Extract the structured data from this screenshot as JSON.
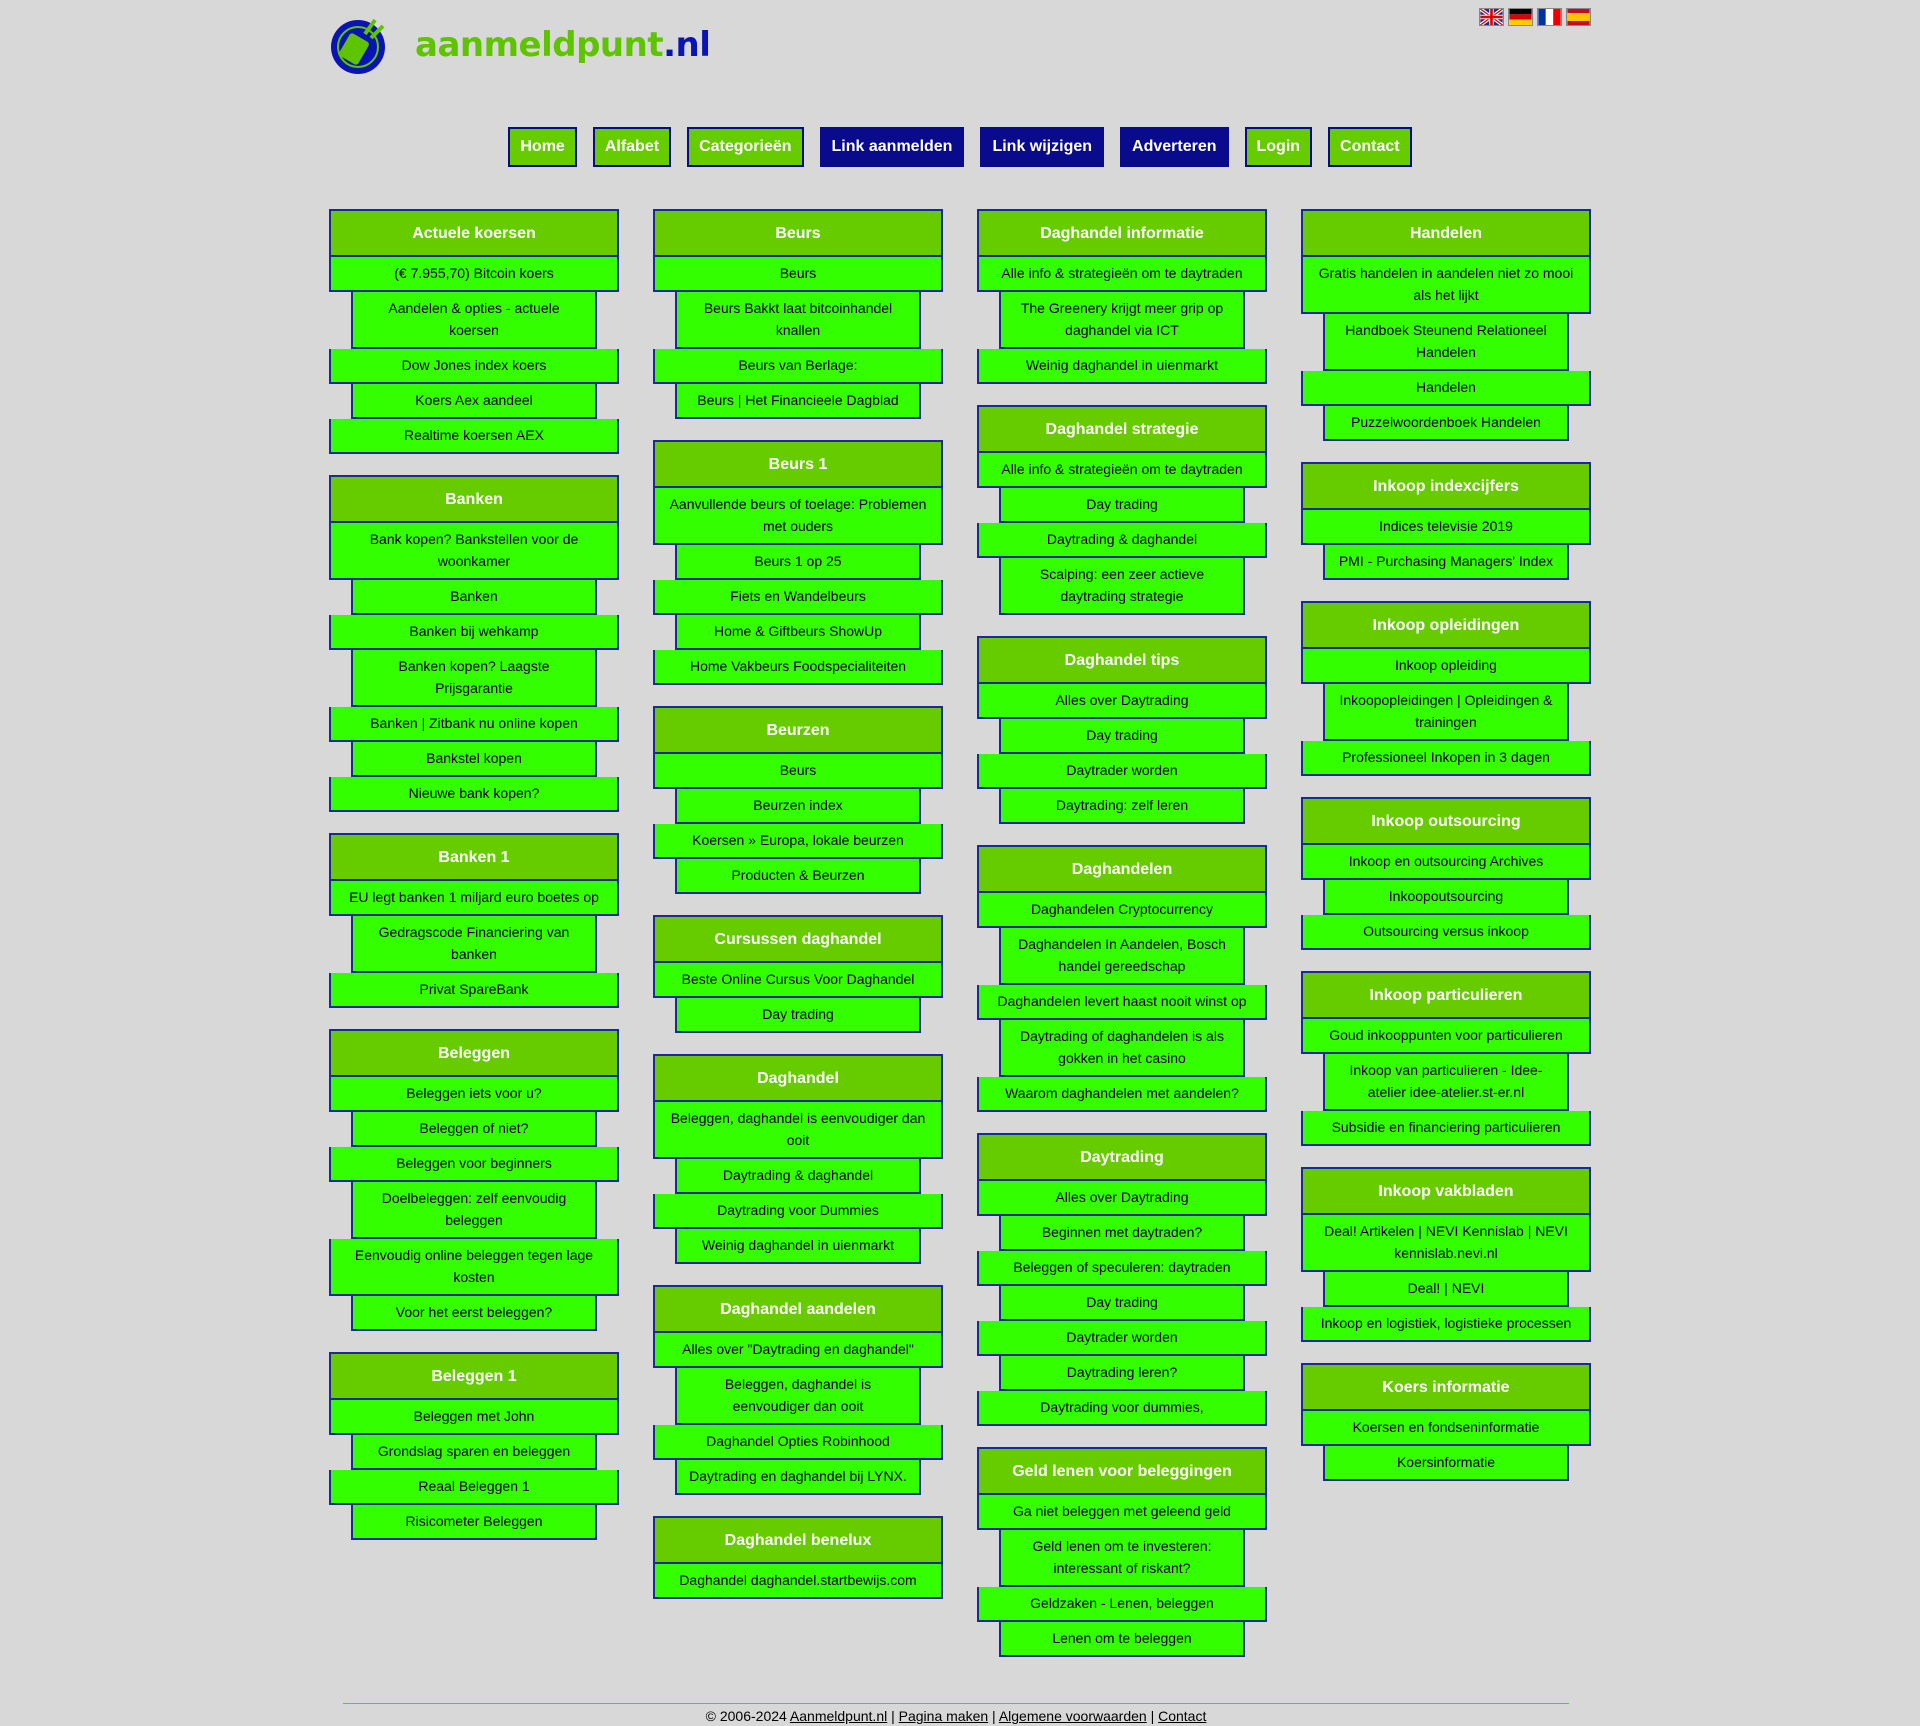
{
  "site": {
    "logo_text_green": "aanmeldpunt",
    "logo_text_blue": ".nl",
    "flags": [
      "flag-uk-icon",
      "flag-de-icon",
      "flag-fr-icon",
      "flag-es-icon"
    ]
  },
  "nav": [
    {
      "label": "Home",
      "dark": false
    },
    {
      "label": "Alfabet",
      "dark": false
    },
    {
      "label": "Categorieën",
      "dark": false
    },
    {
      "label": "Link aanmelden",
      "dark": true
    },
    {
      "label": "Link wijzigen",
      "dark": true
    },
    {
      "label": "Adverteren",
      "dark": true
    },
    {
      "label": "Login",
      "dark": false
    },
    {
      "label": "Contact",
      "dark": false
    }
  ],
  "columns": [
    [
      {
        "title": "Actuele koersen",
        "links": [
          "(€ 7.955,70) Bitcoin koers",
          "Aandelen & opties - actuele koersen",
          "Dow Jones index koers",
          "Koers Aex aandeel",
          "Realtime koersen AEX"
        ]
      },
      {
        "title": "Banken",
        "links": [
          "Bank kopen? Bankstellen voor de woonkamer",
          "Banken",
          "Banken bij wehkamp",
          "Banken kopen? Laagste Prijsgarantie",
          "Banken | Zitbank nu online kopen",
          "Bankstel kopen",
          "Nieuwe bank kopen?"
        ]
      },
      {
        "title": "Banken 1",
        "links": [
          "EU legt banken 1 miljard euro boetes op",
          "Gedragscode Financiering van banken",
          "Privat SpareBank"
        ]
      },
      {
        "title": "Beleggen",
        "links": [
          "Beleggen iets voor u?",
          "Beleggen of niet?",
          "Beleggen voor beginners",
          "Doelbeleggen: zelf eenvoudig beleggen",
          "Eenvoudig online beleggen tegen lage kosten",
          "Voor het eerst beleggen?"
        ]
      },
      {
        "title": "Beleggen 1",
        "links": [
          "Beleggen met John",
          "Grondslag sparen en beleggen",
          "Reaal Beleggen 1",
          "Risicometer Beleggen"
        ]
      }
    ],
    [
      {
        "title": "Beurs",
        "links": [
          "Beurs",
          "Beurs Bakkt laat bitcoinhandel knallen",
          "Beurs van Berlage:",
          "Beurs | Het Financieele Dagblad"
        ]
      },
      {
        "title": "Beurs 1",
        "links": [
          "Aanvullende beurs of toelage: Problemen met ouders",
          "Beurs 1 op 25",
          "Fiets en Wandelbeurs",
          "Home & Giftbeurs ShowUp",
          "Home Vakbeurs Foodspecialiteiten"
        ]
      },
      {
        "title": "Beurzen",
        "links": [
          "Beurs",
          "Beurzen index",
          "Koersen » Europa, lokale beurzen",
          "Producten & Beurzen"
        ]
      },
      {
        "title": "Cursussen daghandel",
        "links": [
          "Beste Online Cursus Voor Daghandel",
          "Day trading"
        ]
      },
      {
        "title": "Daghandel",
        "links": [
          "Beleggen, daghandel is eenvoudiger dan ooit",
          "Daytrading & daghandel",
          "Daytrading voor Dummies",
          "Weinig daghandel in uienmarkt"
        ]
      },
      {
        "title": "Daghandel aandelen",
        "links": [
          "Alles over \"Daytrading en daghandel\"",
          "Beleggen, daghandel is eenvoudiger dan ooit",
          "Daghandel Opties Robinhood",
          "Daytrading en daghandel bij LYNX."
        ]
      },
      {
        "title": "Daghandel benelux",
        "links": [
          "Daghandel daghandel.startbewijs.com"
        ]
      }
    ],
    [
      {
        "title": "Daghandel informatie",
        "links": [
          "Alle info & strategieën om te daytraden",
          "The Greenery krijgt meer grip op daghandel via ICT",
          "Weinig daghandel in uienmarkt"
        ]
      },
      {
        "title": "Daghandel strategie",
        "links": [
          "Alle info & strategieën om te daytraden",
          "Day trading",
          "Daytrading & daghandel",
          "Scalping: een zeer actieve daytrading strategie"
        ]
      },
      {
        "title": "Daghandel tips",
        "links": [
          "Alles over Daytrading",
          "Day trading",
          "Daytrader worden",
          "Daytrading: zelf leren"
        ]
      },
      {
        "title": "Daghandelen",
        "links": [
          "Daghandelen Cryptocurrency",
          "Daghandelen In Aandelen, Bosch handel gereedschap",
          "Daghandelen levert haast nooit winst op",
          "Daytrading of daghandelen is als gokken in het casino",
          "Waarom daghandelen met aandelen?"
        ]
      },
      {
        "title": "Daytrading",
        "links": [
          "Alles over Daytrading",
          "Beginnen met daytraden?",
          "Beleggen of speculeren: daytraden",
          "Day trading",
          "Daytrader worden",
          "Daytrading leren?",
          "Daytrading voor dummies,"
        ]
      },
      {
        "title": "Geld lenen voor beleggingen",
        "links": [
          "Ga niet beleggen met geleend geld",
          "Geld lenen om te investeren: interessant of riskant?",
          "Geldzaken - Lenen, beleggen",
          "Lenen om te beleggen"
        ]
      }
    ],
    [
      {
        "title": "Handelen",
        "links": [
          "Gratis handelen in aandelen niet zo mooi als het lijkt",
          "Handboek Steunend Relationeel Handelen",
          "Handelen",
          "Puzzelwoordenboek Handelen"
        ]
      },
      {
        "title": "Inkoop indexcijfers",
        "links": [
          "Indices televisie 2019",
          "PMI - Purchasing Managers' Index"
        ]
      },
      {
        "title": "Inkoop opleidingen",
        "links": [
          "Inkoop opleiding",
          "Inkoopopleidingen | Opleidingen & trainingen",
          "Professioneel Inkopen in 3 dagen"
        ]
      },
      {
        "title": "Inkoop outsourcing",
        "links": [
          "Inkoop en outsourcing Archives",
          "Inkoopoutsourcing",
          "Outsourcing versus inkoop"
        ]
      },
      {
        "title": "Inkoop particulieren",
        "links": [
          "Goud inkooppunten voor particulieren",
          "Inkoop van particulieren - Idee-atelier idee-atelier.st-er.nl",
          "Subsidie en financiering particulieren"
        ]
      },
      {
        "title": "Inkoop vakbladen",
        "links": [
          "Deal! Artikelen | NEVI Kennislab | NEVI kennislab.nevi.nl",
          "Deal! | NEVI",
          "Inkoop en logistiek, logistieke processen"
        ]
      },
      {
        "title": "Koers informatie",
        "links": [
          "Koersen en fondseninformatie",
          "Koersinformatie"
        ]
      }
    ]
  ],
  "footer": {
    "copyright": "© 2006-2024 ",
    "site_link": "Aanmeldpunt.nl",
    "sep": " | ",
    "page_link": "Pagina maken",
    "terms_link": "Algemene voorwaarden",
    "contact_link": "Contact"
  }
}
